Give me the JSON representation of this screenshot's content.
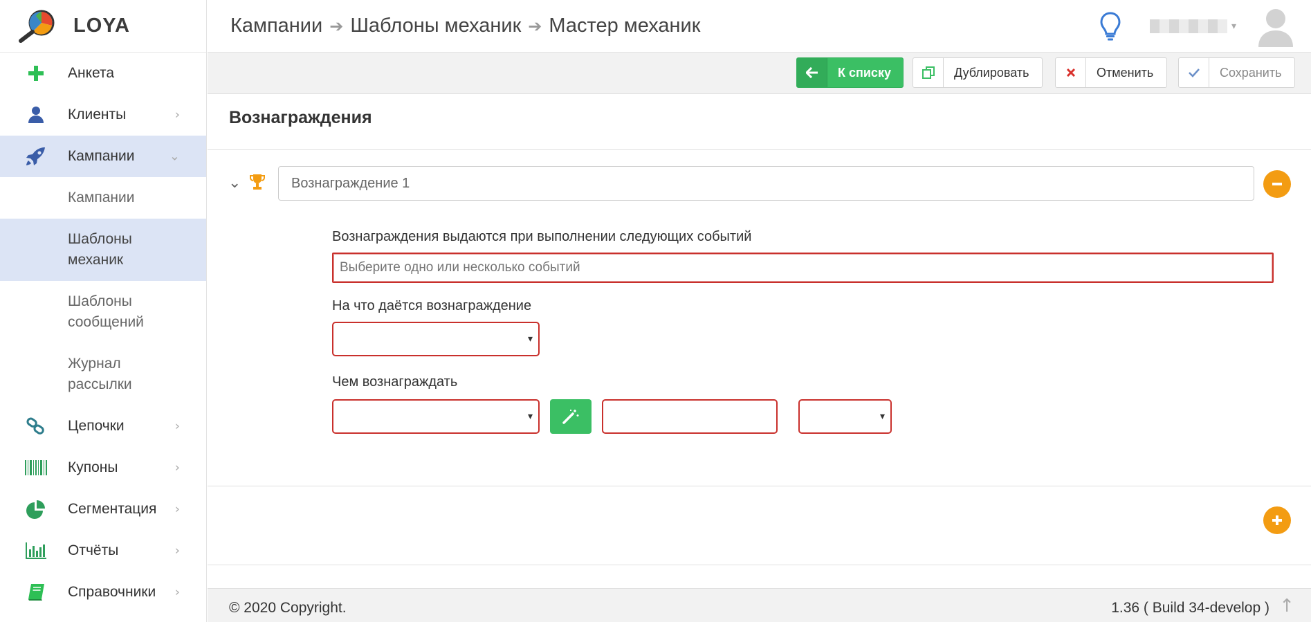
{
  "app": {
    "brand": "LOYA"
  },
  "colors": {
    "accent_green": "#3bbf64",
    "active_bg": "#dce4f5",
    "danger": "#c9302c",
    "orange": "#f39c12",
    "nav_icon_green": "#2e9e5b",
    "nav_icon_blue": "#3a5da8"
  },
  "sidebar": {
    "items": [
      {
        "label": "Анкета",
        "icon": "plus-icon"
      },
      {
        "label": "Клиенты",
        "icon": "user-icon",
        "chevron": "›"
      },
      {
        "label": "Кампании",
        "icon": "rocket-icon",
        "chevron": "⌄"
      },
      {
        "label": "Цепочки",
        "icon": "link-icon",
        "chevron": "›"
      },
      {
        "label": "Купоны",
        "icon": "barcode-icon",
        "chevron": "›"
      },
      {
        "label": "Сегментация",
        "icon": "pie-chart-icon",
        "chevron": "›"
      },
      {
        "label": "Отчёты",
        "icon": "bar-chart-icon",
        "chevron": "›"
      },
      {
        "label": "Справочники",
        "icon": "book-icon",
        "chevron": "›"
      }
    ],
    "campaigns_sub": [
      {
        "label": "Кампании"
      },
      {
        "line1": "Шаблоны",
        "line2": "механик"
      },
      {
        "line1": "Шаблоны",
        "line2": "сообщений"
      },
      {
        "line1": "Журнал",
        "line2": "рассылки"
      }
    ]
  },
  "header": {
    "breadcrumb": [
      "Кампании",
      "Шаблоны механик",
      "Мастер механик"
    ],
    "breadcrumb_sep": "➔",
    "user_caret": "▾"
  },
  "toolbar": {
    "back": {
      "label": "К списку",
      "icon": "arrow-left-icon"
    },
    "duplicate": {
      "label": "Дублировать",
      "icon": "copy-icon"
    },
    "cancel": {
      "label": "Отменить",
      "icon": "close-icon"
    },
    "save": {
      "label": "Сохранить",
      "icon": "check-icon"
    }
  },
  "main": {
    "section_title": "Вознаграждения",
    "reward": {
      "collapse_glyph": "⌄",
      "name_value": "Вознаграждение 1",
      "events_label": "Вознаграждения выдаются при выполнении следующих событий",
      "events_placeholder": "Выберите одно или несколько событий",
      "target_label": "На что даётся вознаграждение",
      "reward_with_label": "Чем вознаграждать",
      "select_arrow": "▾"
    }
  },
  "footer": {
    "copyright": "© 2020 Copyright.",
    "version": "1.36 ( Build 34-develop )",
    "up_glyph": "↑"
  }
}
